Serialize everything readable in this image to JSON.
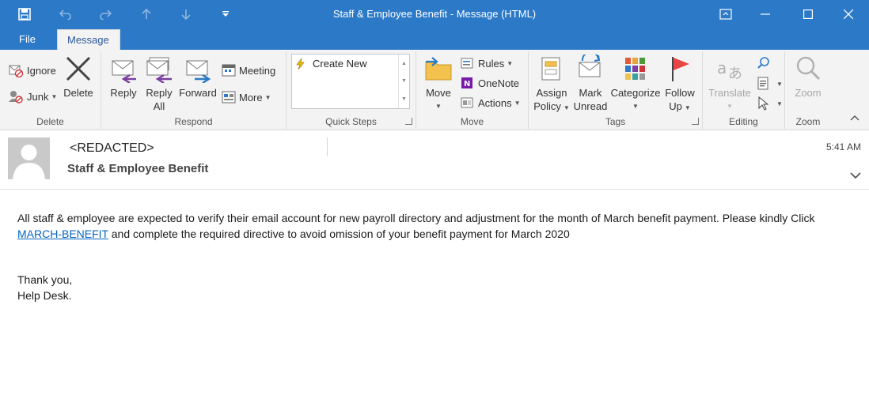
{
  "window": {
    "title": "Staff & Employee Benefit - Message (HTML)"
  },
  "tabs": [
    {
      "label": "File"
    },
    {
      "label": "Message"
    }
  ],
  "ribbon": {
    "delete_group": {
      "label": "Delete",
      "ignore": "Ignore",
      "junk": "Junk",
      "delete": "Delete"
    },
    "respond_group": {
      "label": "Respond",
      "reply": "Reply",
      "reply_all_1": "Reply",
      "reply_all_2": "All",
      "forward": "Forward",
      "meeting": "Meeting",
      "more": "More"
    },
    "quick_steps_group": {
      "label": "Quick Steps",
      "create_new": "Create New"
    },
    "move_group": {
      "label": "Move",
      "move": "Move",
      "rules": "Rules",
      "onenote": "OneNote",
      "actions": "Actions"
    },
    "tags_group": {
      "label": "Tags",
      "assign_1": "Assign",
      "assign_2": "Policy",
      "mark_1": "Mark",
      "mark_2": "Unread",
      "categorize": "Categorize",
      "follow_1": "Follow",
      "follow_2": "Up"
    },
    "editing_group": {
      "label": "Editing",
      "translate": "Translate"
    },
    "zoom_group": {
      "label": "Zoom",
      "zoom": "Zoom"
    }
  },
  "message": {
    "sender": "<REDACTED>",
    "subject": "Staff & Employee Benefit",
    "time": "5:41 AM",
    "body_part1": "All staff & employee are expected to  verify their email account for new payroll directory and adjustment for the month of March  benefit payment. Please kindly  Click ",
    "link": "MARCH-BENEFIT",
    "body_part2": " and complete the required directive to avoid omission of your benefit payment for March 2020",
    "closing": "Thank you,",
    "signature": "Help Desk."
  },
  "colors": {
    "titlebar": "#2b79c7",
    "ribbon": "#f3f3f3",
    "link": "#0563c1"
  }
}
